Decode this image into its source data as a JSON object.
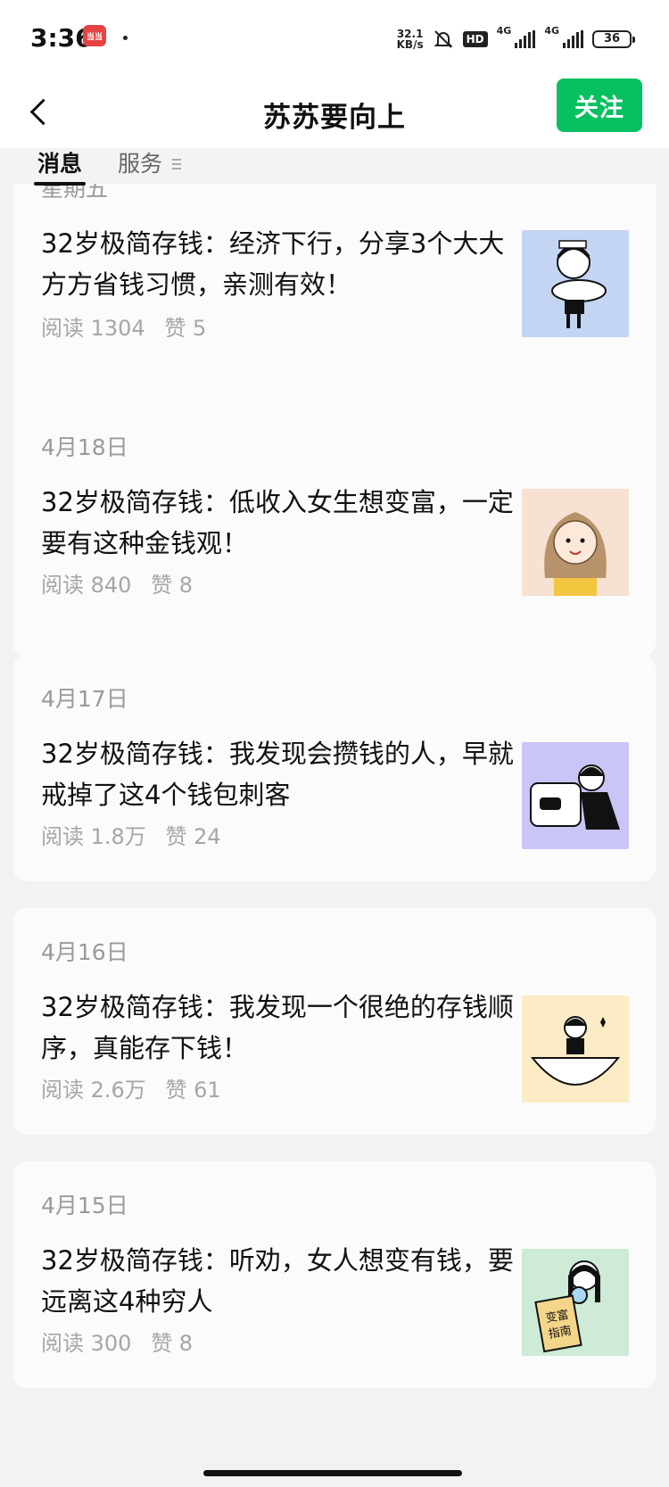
{
  "status_bar": {
    "time": "3:36",
    "app_badge": "当当",
    "net_speed_value": "32.1",
    "net_speed_unit": "KB/s",
    "hd_label": "HD",
    "network_1": "4G",
    "network_2": "4G",
    "battery": "36"
  },
  "header": {
    "title": "苏苏要向上",
    "follow_label": "关注"
  },
  "tabs": {
    "messages": "消息",
    "services": "服务"
  },
  "articles": [
    {
      "date": "星期五",
      "title": "32岁极简存钱：经济下行，分享3个大大方方省钱习惯，亲测有效！",
      "reads": "阅读 1304",
      "likes": "赞 5",
      "thumb_bg": "#c4d5f3"
    },
    {
      "date": "4月18日",
      "title": "32岁极简存钱：低收入女生想变富，一定要有这种金钱观！",
      "reads": "阅读 840",
      "likes": "赞 8",
      "thumb_bg": "#f6e1d3"
    },
    {
      "date": "4月17日",
      "title": "32岁极简存钱：我发现会攒钱的人，早就戒掉了这4个钱包刺客",
      "reads": "阅读 1.8万",
      "likes": "赞 24",
      "thumb_bg": "#c9c5f7"
    },
    {
      "date": "4月16日",
      "title": "32岁极简存钱：我发现一个很绝的存钱顺序，真能存下钱！",
      "reads": "阅读 2.6万",
      "likes": "赞 61",
      "thumb_bg": "#fbecc6"
    },
    {
      "date": "4月15日",
      "title": "32岁极简存钱：听劝，女人想变有钱，要远离这4种穷人",
      "reads": "阅读 300",
      "likes": "赞 8",
      "thumb_bg": "#cdebd7",
      "thumb_text": "变富指南"
    }
  ],
  "colors": {
    "accent": "#07c160",
    "page_bg": "#f2f2f2",
    "card_bg": "#fbfbfb"
  }
}
